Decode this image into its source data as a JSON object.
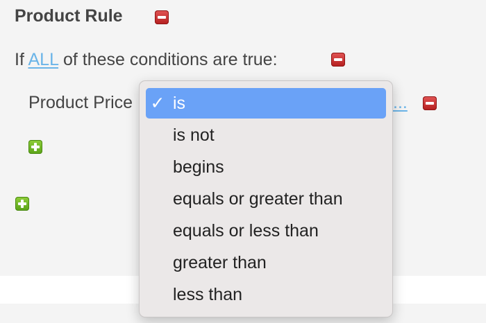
{
  "rule": {
    "title": "Product Rule"
  },
  "conditions_line": {
    "prefix": "If",
    "match_mode": "ALL",
    "suffix": "of these conditions are true:"
  },
  "condition": {
    "field": "Product Price",
    "operator_link_tail": "..."
  },
  "operator_menu": {
    "selected_check": "✓",
    "options": [
      {
        "label": "is",
        "selected": true
      },
      {
        "label": "is not",
        "selected": false
      },
      {
        "label": "begins",
        "selected": false
      },
      {
        "label": "equals or greater than",
        "selected": false
      },
      {
        "label": "equals or less than",
        "selected": false
      },
      {
        "label": "greater than",
        "selected": false
      },
      {
        "label": "less than",
        "selected": false
      }
    ]
  },
  "colors": {
    "link": "#6ab4e8",
    "remove_button": "#c8282a",
    "add_button": "#6cb524",
    "selected_option": "#6aa2f7"
  },
  "icons": {
    "remove": "minus-icon",
    "add": "plus-icon",
    "check": "checkmark-icon"
  }
}
